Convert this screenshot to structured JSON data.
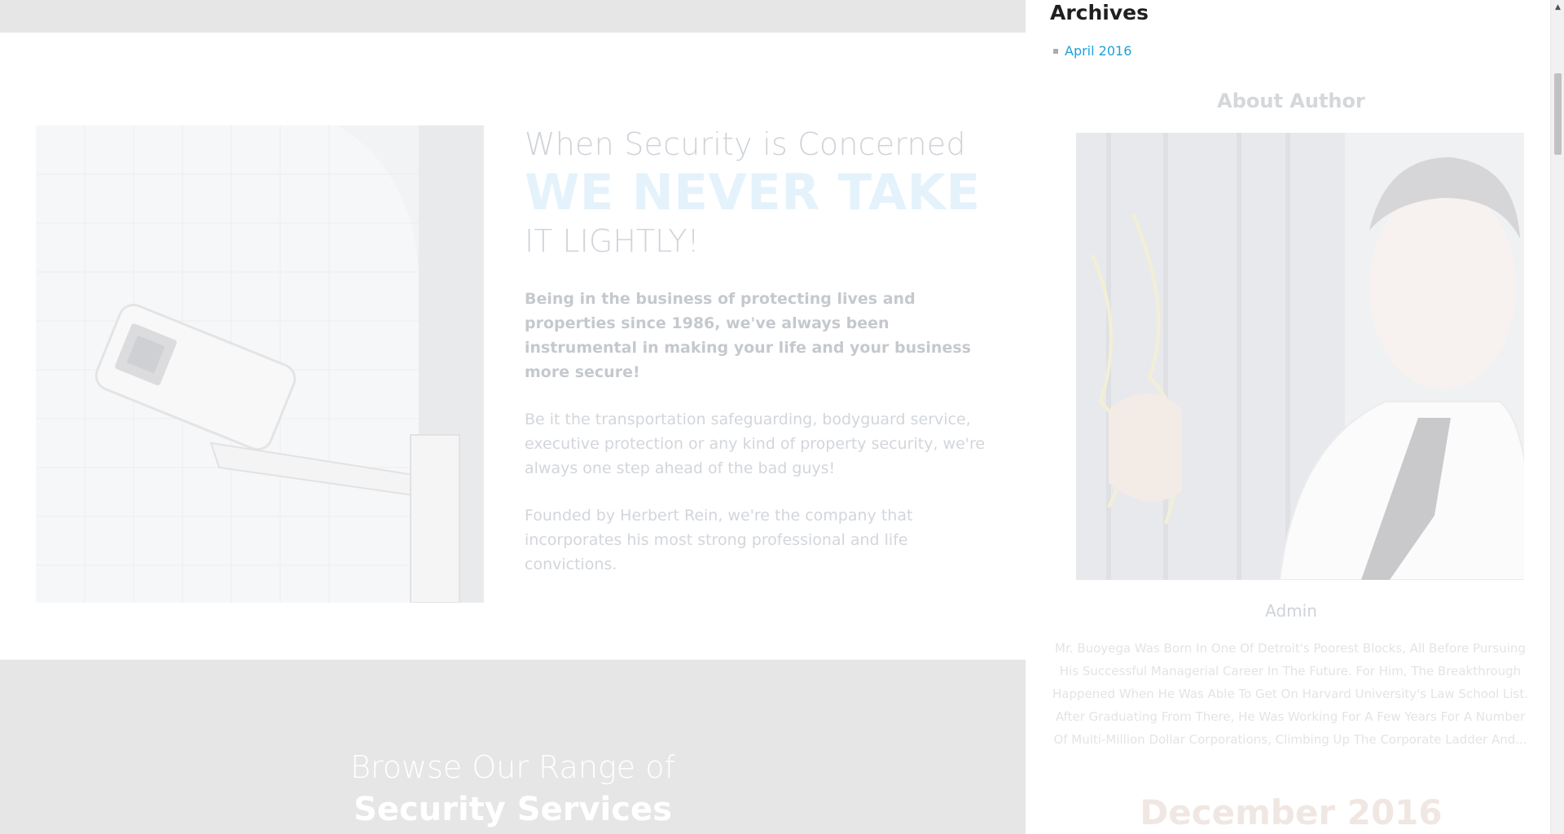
{
  "about": {
    "heading_line1": "When Security is Concerned",
    "heading_line2": "WE NEVER TAKE",
    "heading_line3": "IT LIGHTLY!",
    "lead": "Being in the business of protecting lives and properties since 1986, we've always been instrumental in making your life and your business more secure!",
    "paragraph1": "Be it the transportation safeguarding, bodyguard service, executive protection or any kind of property security, we're always one step ahead of the bad guys!",
    "paragraph2": "Founded by Herbert Rein, we're the company that incorporates his most strong professional and life convictions."
  },
  "services": {
    "title_line1": "Browse Our Range of",
    "title_line2": "Security Services"
  },
  "sidebar": {
    "archives_title": "Archives",
    "archives": [
      "April 2016"
    ],
    "about_author_title": "About Author",
    "author_name": "Admin",
    "author_bio": "Mr. Buoyega Was Born In One Of Detroit's Poorest Blocks, All Before Pursuing His Successful Managerial Career In The Future. For Him, The Breakthrough Happened When He Was Able To Get On Harvard University's Law School List. After Graduating From There, He Was Working For A Few Years For A Number Of Multi-Million Dollar Corporations, Climbing Up The Corporate Ladder And...",
    "calendar_title": "December 2016"
  },
  "scrollbar": {
    "up_icon": "▲"
  },
  "colors": {
    "accent_link": "#1fa0d8",
    "band_gray": "#e6e6e7",
    "heading_dark": "#1f1f1f"
  }
}
